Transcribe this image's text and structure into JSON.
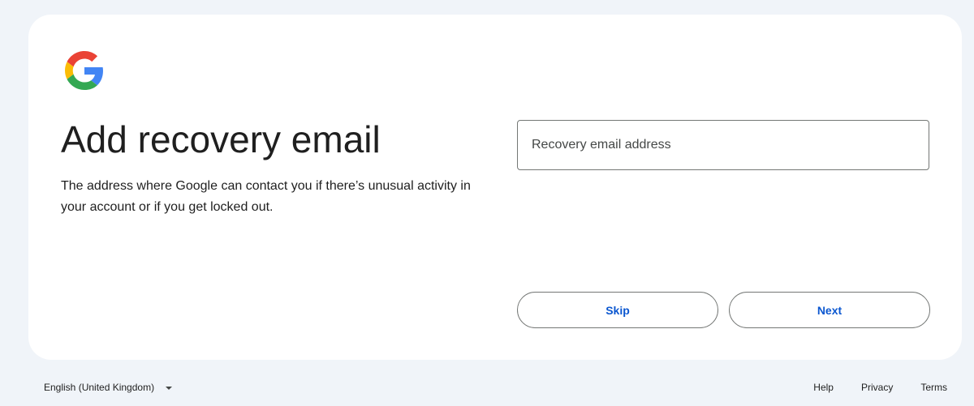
{
  "brand": {
    "logo_icon": "google-g-logo",
    "colors": {
      "blue": "#4285F4",
      "red": "#EA4335",
      "yellow": "#FBBC05",
      "green": "#34A853",
      "accent": "#0b57d0"
    }
  },
  "main": {
    "title": "Add recovery email",
    "description": "The address where Google can contact you if there’s unusual activity in your account or if you get locked out."
  },
  "form": {
    "email": {
      "value": "",
      "placeholder": "Recovery email address"
    },
    "skip_label": "Skip",
    "next_label": "Next"
  },
  "footer": {
    "language": "English (United Kingdom)",
    "links": {
      "help": "Help",
      "privacy": "Privacy",
      "terms": "Terms"
    }
  }
}
